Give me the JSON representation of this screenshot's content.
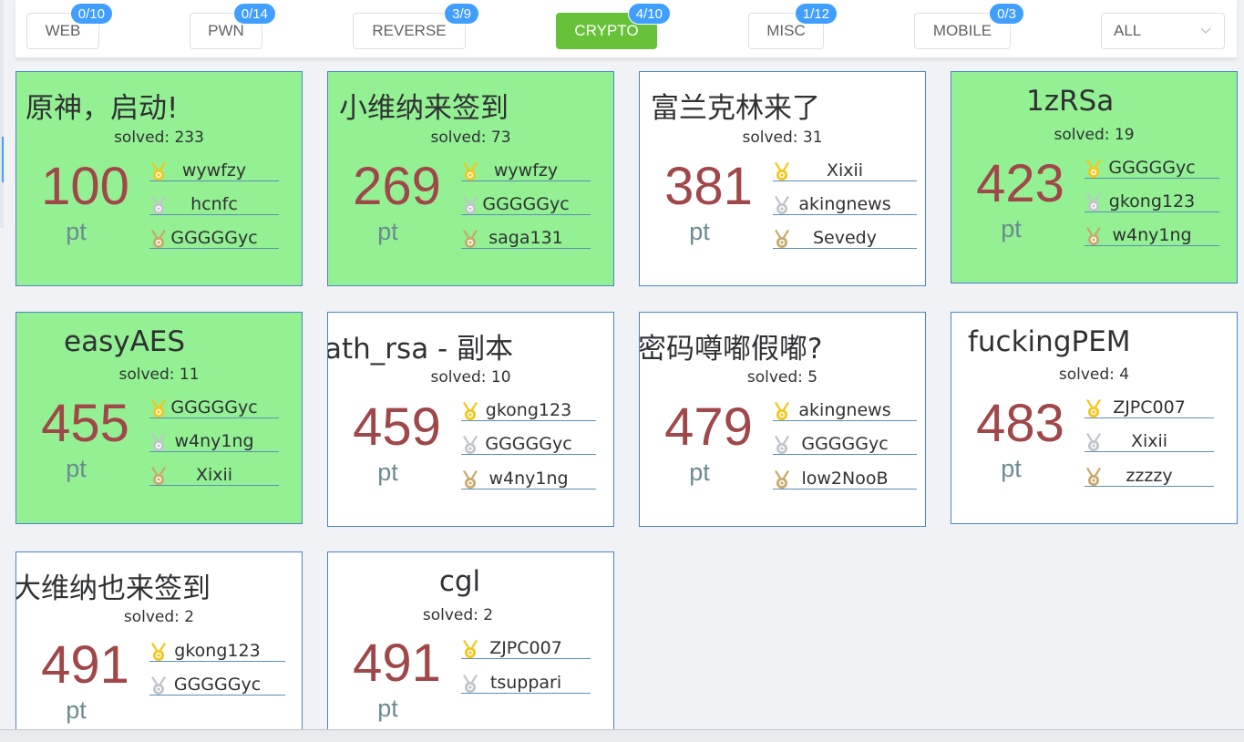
{
  "categories": [
    {
      "label": "WEB",
      "badge": "0/10"
    },
    {
      "label": "PWN",
      "badge": "0/14"
    },
    {
      "label": "REVERSE",
      "badge": "3/9"
    },
    {
      "label": "CRYPTO",
      "badge": "4/10"
    },
    {
      "label": "MISC",
      "badge": "1/12"
    },
    {
      "label": "MOBILE",
      "badge": "0/3"
    }
  ],
  "filter": {
    "selected": "ALL"
  },
  "unit": "pt",
  "medal_icons": [
    "gold-medal-icon",
    "silver-medal-icon",
    "bronze-medal-icon"
  ],
  "colors": {
    "solved_card": "#93f093",
    "active_tab": "#67c23a",
    "badge": "#409eff",
    "score": "#a0474a"
  },
  "challenges": [
    {
      "title": "原神，启动!",
      "solved": "solved: 233",
      "score": "100",
      "solvers": [
        "wywfzy",
        "hcnfc",
        "GGGGGyc"
      ]
    },
    {
      "title": "小维纳来签到",
      "solved": "solved: 73",
      "score": "269",
      "solvers": [
        "wywfzy",
        "GGGGGyc",
        "saga131"
      ]
    },
    {
      "title": "富兰克林来了",
      "solved": "solved: 31",
      "score": "381",
      "solvers": [
        "Xixii",
        "akingnews",
        "Sevedy"
      ]
    },
    {
      "title": "1zRSa",
      "solved": "solved: 19",
      "score": "423",
      "solvers": [
        "GGGGGyc",
        "gkong123",
        "w4ny1ng"
      ]
    },
    {
      "title": "easyAES",
      "solved": "solved: 11",
      "score": "455",
      "solvers": [
        "GGGGGyc",
        "w4ny1ng",
        "Xixii"
      ]
    },
    {
      "title": "ath_rsa - 副本",
      "solved": "solved: 10",
      "score": "459",
      "solvers": [
        "gkong123",
        "GGGGGyc",
        "w4ny1ng"
      ]
    },
    {
      "title": "密码噂嘟假嘟?",
      "solved": "solved: 5",
      "score": "479",
      "solvers": [
        "akingnews",
        "GGGGGyc",
        "low2NooB"
      ]
    },
    {
      "title": "fuckingPEM",
      "solved": "solved: 4",
      "score": "483",
      "solvers": [
        "ZJPC007",
        "Xixii",
        "zzzzy"
      ]
    },
    {
      "title": "大维纳也来签到",
      "solved": "solved: 2",
      "score": "491",
      "solvers": [
        "gkong123",
        "GGGGGyc"
      ]
    },
    {
      "title": "cgl",
      "solved": "solved: 2",
      "score": "491",
      "solvers": [
        "ZJPC007",
        "tsuppari"
      ]
    }
  ]
}
